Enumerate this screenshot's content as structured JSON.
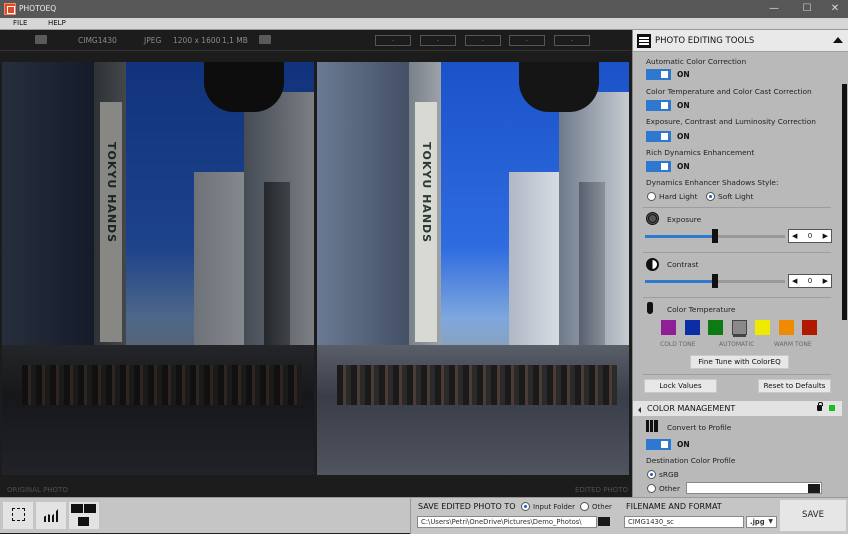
{
  "window": {
    "title": "PHOTOEQ",
    "controls": {
      "minimize": "—",
      "maximize": "☐",
      "close": "✕"
    }
  },
  "menu": {
    "items": [
      {
        "label": "FILE"
      },
      {
        "label": "HELP"
      }
    ]
  },
  "info_bar": {
    "filename": "CIMG1430",
    "format": "JPEG",
    "dimensions": "1200 x 1600",
    "filesize": "1,1 MB",
    "nav_boxes": [
      "-",
      "-",
      "-",
      "-",
      "-"
    ]
  },
  "photos": {
    "original_label": "ORIGINAL PHOTO",
    "edited_label": "EDITED PHOTO",
    "sign_text": "TOKYU HANDS"
  },
  "panel": {
    "title": "PHOTO EDITING TOOLS",
    "toggles": [
      {
        "label": "Automatic Color Correction",
        "state": "ON"
      },
      {
        "label": "Color Temperature and Color Cast Correction",
        "state": "ON"
      },
      {
        "label": "Exposure, Contrast and Luminosity Correction",
        "state": "ON"
      },
      {
        "label": "Rich Dynamics Enhancement",
        "state": "ON"
      }
    ],
    "shadows_style": {
      "label": "Dynamics Enhancer Shadows Style:",
      "options": [
        "Hard Light",
        "Soft Light"
      ],
      "selected": "Soft Light"
    },
    "exposure": {
      "label": "Exposure",
      "value": "0",
      "slider_fraction": 0.5
    },
    "contrast": {
      "label": "Contrast",
      "value": "0",
      "slider_fraction": 0.5
    },
    "color_temperature": {
      "label": "Color Temperature",
      "swatches": [
        {
          "name": "purple",
          "color": "#8e1f97"
        },
        {
          "name": "blue",
          "color": "#0b2ea6"
        },
        {
          "name": "green",
          "color": "#0e7a13"
        },
        {
          "name": "automatic",
          "color": "#8a8a8a"
        },
        {
          "name": "yellow",
          "color": "#f0ea00"
        },
        {
          "name": "orange",
          "color": "#f08a00"
        },
        {
          "name": "red",
          "color": "#b01800"
        }
      ],
      "selected": "automatic",
      "labels": {
        "cold": "COLD TONE",
        "auto": "AUTOMATIC",
        "warm": "WARM TONE"
      },
      "fine_tune_label": "Fine Tune with ColorEQ"
    },
    "lock_values_label": "Lock Values",
    "reset_label": "Reset to Defaults",
    "color_management": {
      "title": "COLOR MANAGEMENT",
      "convert_label": "Convert to Profile",
      "convert_state": "ON",
      "destination_label": "Destination Color Profile",
      "options": [
        "sRGB",
        "Other"
      ],
      "selected": "sRGB",
      "other_value": ""
    }
  },
  "bottom": {
    "save_to_label": "SAVE EDITED PHOTO TO",
    "save_to_options": [
      "Input Folder",
      "Other"
    ],
    "save_to_selected": "Input Folder",
    "path": "C:\\Users\\Petri\\OneDrive\\Pictures\\Demo_Photos\\",
    "filename_label": "FILENAME AND FORMAT",
    "filename": "CIMG1430_sc",
    "format": ".jpg",
    "save_label": "SAVE"
  },
  "colors": {
    "accent": "#2f78cf",
    "status_ok": "#19c019"
  }
}
